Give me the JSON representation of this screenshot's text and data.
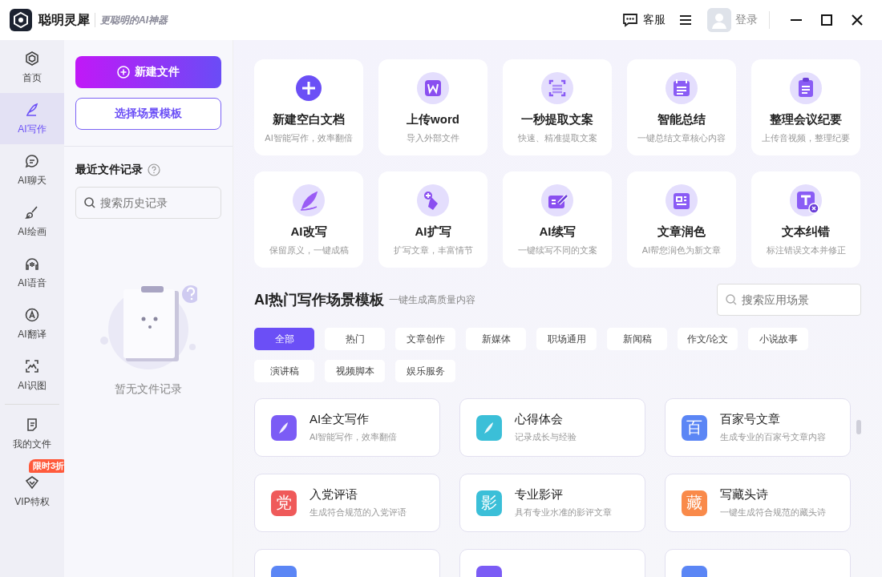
{
  "app": {
    "name": "聪明灵犀",
    "slogan": "更聪明的AI神器"
  },
  "title_bar": {
    "service": "客服",
    "login": "登录"
  },
  "nav": {
    "items": [
      {
        "label": "首页",
        "selected": false
      },
      {
        "label": "AI写作",
        "selected": true
      },
      {
        "label": "AI聊天",
        "selected": false
      },
      {
        "label": "AI绘画",
        "selected": false
      },
      {
        "label": "AI语音",
        "selected": false
      },
      {
        "label": "AI翻译",
        "selected": false
      },
      {
        "label": "AI识图",
        "selected": false
      }
    ],
    "bottom": [
      {
        "label": "我的文件"
      },
      {
        "label": "VIP特权",
        "badge": "限时3折"
      }
    ]
  },
  "left_panel": {
    "new_button": "新建文件",
    "template_button": "选择场景模板",
    "recent_title": "最近文件记录",
    "search": {
      "placeholder": "搜索历史记录"
    },
    "empty_text": "暂无文件记录"
  },
  "tools": [
    {
      "title": "新建空白文档",
      "subtitle": "AI智能写作，效率翻倍"
    },
    {
      "title": "上传word",
      "subtitle": "导入外部文件"
    },
    {
      "title": "一秒提取文案",
      "subtitle": "快速、精准提取文案"
    },
    {
      "title": "智能总结",
      "subtitle": "一键总结文章核心内容"
    },
    {
      "title": "整理会议纪要",
      "subtitle": "上传音视频，整理纪要"
    },
    {
      "title": "AI改写",
      "subtitle": "保留原义，一键成稿"
    },
    {
      "title": "AI扩写",
      "subtitle": "扩写文章，丰富情节"
    },
    {
      "title": "AI续写",
      "subtitle": "一键续写不同的文案"
    },
    {
      "title": "文章润色",
      "subtitle": "AI帮您润色为新文章"
    },
    {
      "title": "文本纠错",
      "subtitle": "标注错误文本并修正"
    }
  ],
  "templates": {
    "title": "AI热门写作场景模板",
    "subtitle": "一键生成高质量内容",
    "search": {
      "placeholder": "搜索应用场景"
    },
    "tags": [
      {
        "label": "全部",
        "selected": true
      },
      {
        "label": "热门",
        "selected": false
      },
      {
        "label": "文章创作",
        "selected": false
      },
      {
        "label": "新媒体",
        "selected": false
      },
      {
        "label": "职场通用",
        "selected": false
      },
      {
        "label": "新闻稿",
        "selected": false
      },
      {
        "label": "作文/论文",
        "selected": false
      },
      {
        "label": "小说故事",
        "selected": false
      },
      {
        "label": "演讲稿",
        "selected": false
      },
      {
        "label": "视频脚本",
        "selected": false
      },
      {
        "label": "娱乐服务",
        "selected": false
      }
    ],
    "cards": [
      {
        "title": "AI全文写作",
        "description": "AI智能写作，效率翻倍",
        "color": "#7b5cf5"
      },
      {
        "title": "心得体会",
        "description": "记录成长与经验",
        "color": "#3bbfd8"
      },
      {
        "title": "百家号文章",
        "description": "生成专业的百家号文章内容",
        "icon_char": "百",
        "color": "#5b86f5"
      },
      {
        "title": "入党评语",
        "description": "生成符合规范的入党评语",
        "icon_char": "党",
        "color": "#ef5a5a"
      },
      {
        "title": "专业影评",
        "description": "具有专业水准的影评文章",
        "icon_char": "影",
        "color": "#3bbfd8"
      },
      {
        "title": "写藏头诗",
        "description": "一键生成符合规范的藏头诗",
        "icon_char": "藏",
        "color": "#f98a4a"
      },
      {
        "color": "#5b86f5"
      },
      {
        "color": "#7b5cf5"
      },
      {
        "color": "#5b86f5"
      }
    ]
  }
}
